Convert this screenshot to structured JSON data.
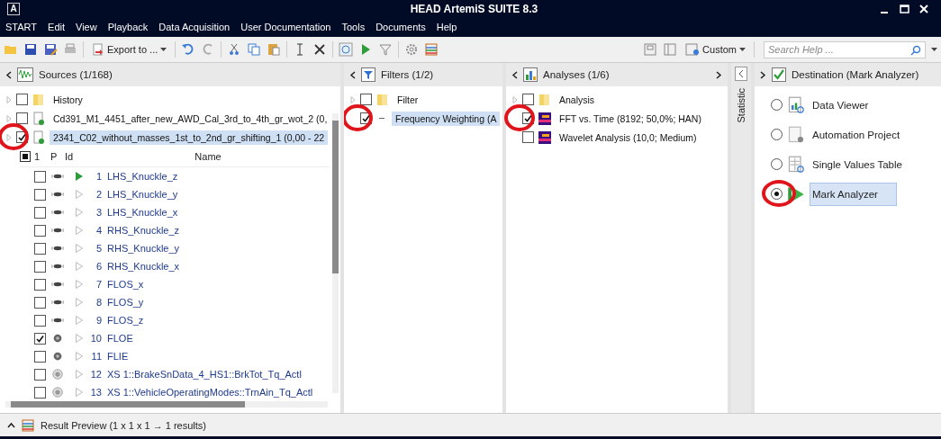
{
  "window": {
    "logo": "A",
    "title": "HEAD ArtemiS SUITE 8.3"
  },
  "menu": [
    "START",
    "Edit",
    "View",
    "Playback",
    "Data Acquisition",
    "User Documentation",
    "Tools",
    "Documents",
    "Help"
  ],
  "toolbar": {
    "export_label": "Export to ...",
    "layout_label": "Custom",
    "search_placeholder": "Search Help ..."
  },
  "sources": {
    "title": "Sources (1/168)",
    "items": [
      {
        "kind": "folder",
        "label": "History",
        "checked": false,
        "selected": false,
        "circled": false
      },
      {
        "kind": "file",
        "label": "Cd391_M1_4451_after_new_AWD_Cal_3rd_to_4th_gr_wot_2 (0,",
        "checked": false,
        "selected": false,
        "circled": false
      },
      {
        "kind": "file",
        "label": "2341_C02_without_masses_1st_to_2nd_gr_shifting_1 (0,00 - 22",
        "checked": true,
        "selected": true,
        "circled": true
      }
    ],
    "select_all_checked": true,
    "columns": [
      "1",
      "P",
      "Id",
      "Name"
    ],
    "channels": [
      {
        "kind": "sensor",
        "id": "1",
        "name": "LHS_Knuckle_z",
        "checked": false,
        "active": true
      },
      {
        "kind": "sensor",
        "id": "2",
        "name": "LHS_Knuckle_y",
        "checked": false,
        "active": false
      },
      {
        "kind": "sensor",
        "id": "3",
        "name": "LHS_Knuckle_x",
        "checked": false,
        "active": false
      },
      {
        "kind": "sensor",
        "id": "4",
        "name": "RHS_Knuckle_z",
        "checked": false,
        "active": false
      },
      {
        "kind": "sensor",
        "id": "5",
        "name": "RHS_Knuckle_y",
        "checked": false,
        "active": false
      },
      {
        "kind": "sensor",
        "id": "6",
        "name": "RHS_Knuckle_x",
        "checked": false,
        "active": false
      },
      {
        "kind": "sensor",
        "id": "7",
        "name": "FLOS_x",
        "checked": false,
        "active": false
      },
      {
        "kind": "sensor",
        "id": "8",
        "name": "FLOS_y",
        "checked": false,
        "active": false
      },
      {
        "kind": "sensor",
        "id": "9",
        "name": "FLOS_z",
        "checked": false,
        "active": false
      },
      {
        "kind": "disk",
        "id": "10",
        "name": "FLOE",
        "checked": true,
        "active": false
      },
      {
        "kind": "disk",
        "id": "11",
        "name": "FLIE",
        "checked": false,
        "active": false
      },
      {
        "kind": "ring",
        "id": "12",
        "name": "XS 1::BrakeSnData_4_HS1::BrkTot_Tq_Actl",
        "checked": false,
        "active": false
      },
      {
        "kind": "ring",
        "id": "13",
        "name": "XS 1::VehicleOperatingModes::TrnAin_Tq_Actl",
        "checked": false,
        "active": false
      }
    ]
  },
  "filters": {
    "title": "Filters (1/2)",
    "items": [
      {
        "kind": "folder",
        "label": "Filter",
        "checked": false,
        "selected": false,
        "circled": false
      },
      {
        "kind": "filter",
        "label": "Frequency Weighting (A",
        "checked": true,
        "selected": true,
        "circled": true
      }
    ]
  },
  "analyses": {
    "title": "Analyses (1/6)",
    "items": [
      {
        "kind": "folder",
        "label": "Analysis",
        "checked": false,
        "selected": false,
        "circled": false
      },
      {
        "kind": "spectrum",
        "label": "FFT vs. Time (8192; 50,0%; HAN)",
        "checked": true,
        "selected": false,
        "circled": true
      },
      {
        "kind": "spectrum",
        "label": "Wavelet Analysis (10,0; Medium)",
        "checked": false,
        "selected": false,
        "circled": false
      }
    ]
  },
  "statistic": {
    "label": "Statistic"
  },
  "destination": {
    "title": "Destination (Mark Analyzer)",
    "options": [
      {
        "label": "Data Viewer",
        "selected": false,
        "circled": false
      },
      {
        "label": "Automation Project",
        "selected": false,
        "circled": false
      },
      {
        "label": "Single Values Table",
        "selected": false,
        "circled": false
      },
      {
        "label": "Mark Analyzer",
        "selected": true,
        "circled": true
      }
    ]
  },
  "status": {
    "label": "Result Preview (1 x 1 x 1 → 1 results)"
  }
}
